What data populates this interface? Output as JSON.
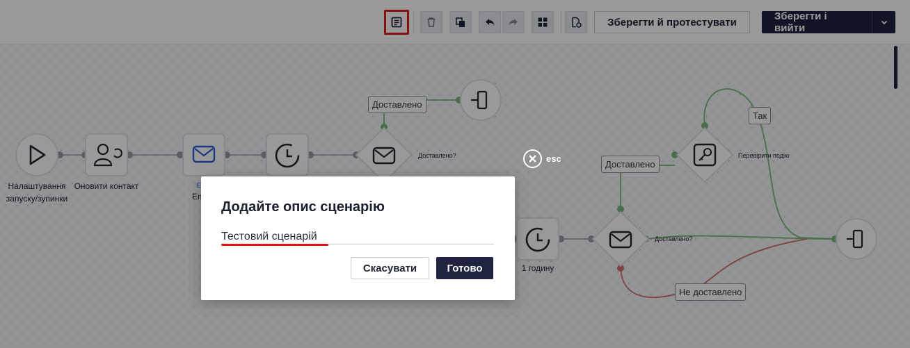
{
  "toolbar": {
    "save_test_label": "Зберегти й протестувати",
    "save_exit_label": "Зберегти і вийти"
  },
  "nodes": {
    "start_label_line1": "Налаштування",
    "start_label_line2": "запуску/зупинки",
    "update_contact_label": "Оновити контакт",
    "email_label_partial_1": "E",
    "email_label_partial_2": "Em",
    "delivered_question_1": "Доставлено?",
    "delivered_question_2": "Доставлено?",
    "check_event_label": "Перевірити подію",
    "wait_label": "1 годину"
  },
  "tags": {
    "delivered_top": "Доставлено",
    "delivered_right": "Доставлено",
    "yes": "Так",
    "not_delivered": "Не доставлено"
  },
  "colors": {
    "success_edge": "#7cb87a",
    "fail_edge": "#d46b68",
    "primary_dark": "#1f2340",
    "highlight_red": "#e01919"
  },
  "overlay": {
    "esc_label": "esc"
  },
  "modal": {
    "title": "Додайте опис сценарію",
    "description_value": "Тестовий сценарій",
    "cancel_label": "Скасувати",
    "done_label": "Готово"
  }
}
